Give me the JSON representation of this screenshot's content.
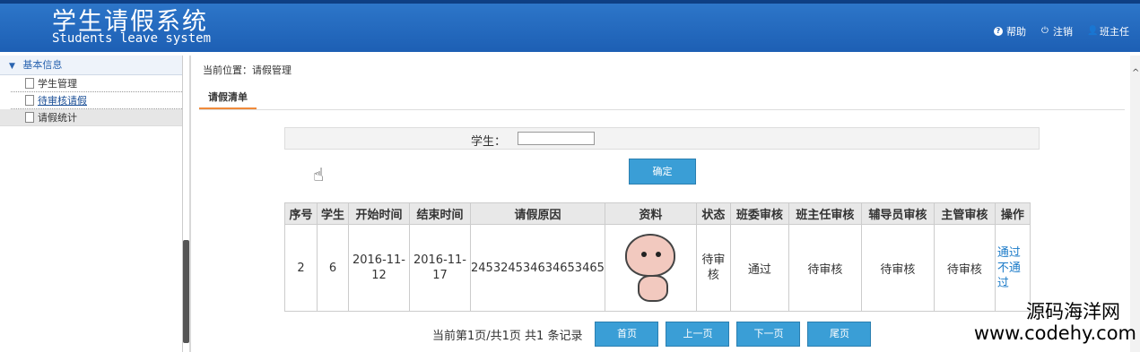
{
  "header": {
    "title_cn": "学生请假系统",
    "title_en": "Students leave system",
    "links": [
      {
        "label": "帮助",
        "icon": "help-icon"
      },
      {
        "label": "注销",
        "icon": "power-icon"
      },
      {
        "label": "班主任",
        "icon": "user-icon"
      }
    ]
  },
  "sidebar": {
    "section": "基本信息",
    "items": [
      {
        "label": "学生管理"
      },
      {
        "label": "待审核请假"
      },
      {
        "label": "请假统计"
      }
    ]
  },
  "main": {
    "breadcrumb": "当前位置：请假管理",
    "tab": "请假清单",
    "search_label": "学生：",
    "search_value": "",
    "confirm_label": "确定"
  },
  "table": {
    "headers": [
      "序号",
      "学生",
      "开始时间",
      "结束时间",
      "请假原因",
      "资料",
      "状态",
      "班委审核",
      "班主任审核",
      "辅导员审核",
      "主管审核",
      "操作"
    ],
    "rows": [
      {
        "id": "2",
        "student": "6",
        "start": "2016-11-12",
        "end": "2016-11-17",
        "reason": "245324534634653465",
        "status": "待审核",
        "monitor_review": "通过",
        "teacher_review": "待审核",
        "counselor_review": "待审核",
        "supervisor_review": "待审核",
        "action_pass": "通过",
        "action_reject": "不通过"
      }
    ]
  },
  "pager": {
    "text": "当前第1页/共1页 共1 条记录",
    "first": "首页",
    "prev": "上一页",
    "next": "下一页",
    "last": "尾页"
  },
  "watermark": {
    "cn": "源码海洋网",
    "en": "www.codehy.com"
  },
  "colors": {
    "header": "#1d5fb4",
    "button": "#3a9ed6",
    "tab_underline": "#f08a3a",
    "link": "#1a7ac8"
  }
}
